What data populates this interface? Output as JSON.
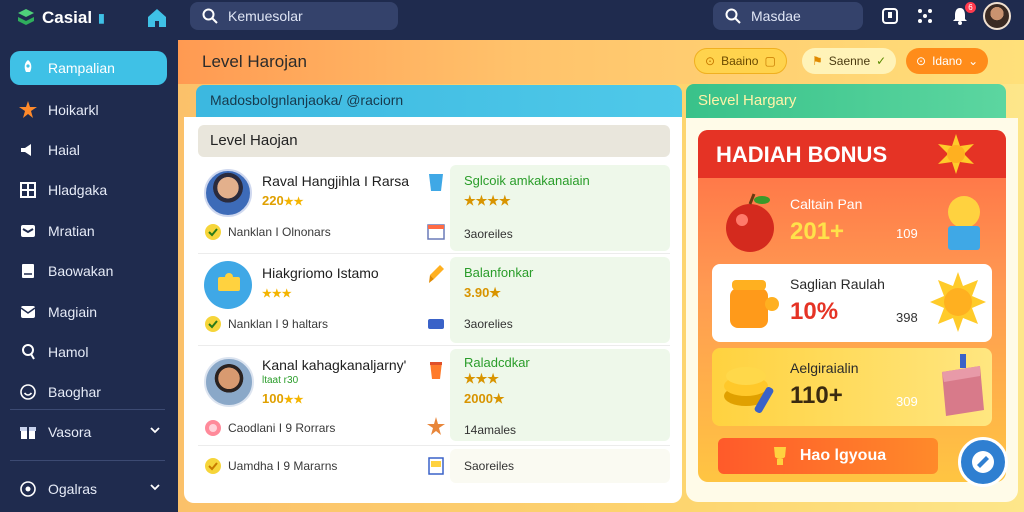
{
  "app": {
    "logo_text": "Casial",
    "top_search_placeholder": "Kemuesolar",
    "top_search2_value": "Masdae",
    "notification_count": "6"
  },
  "sidebar": {
    "items": [
      {
        "label": "Rampalian",
        "icon": "rocket-icon"
      },
      {
        "label": "Hoikarkl",
        "icon": "star-burst-icon"
      },
      {
        "label": "Haial",
        "icon": "speaker-icon"
      },
      {
        "label": "Hladgaka",
        "icon": "grid-icon"
      },
      {
        "label": "Mratian",
        "icon": "mail-icon"
      },
      {
        "label": "Baowakan",
        "icon": "document-icon"
      },
      {
        "label": "Magiain",
        "icon": "envelope-icon"
      },
      {
        "label": "Hamol",
        "icon": "user-icon"
      },
      {
        "label": "Baoghar",
        "icon": "smile-icon"
      },
      {
        "label": "Vasora",
        "icon": "gift-icon"
      },
      {
        "label": "Ogalras",
        "icon": "settings-icon"
      }
    ]
  },
  "header": {
    "title": "Level Harojan",
    "pills": [
      "Baaino",
      "Saenne",
      "Idano"
    ]
  },
  "left": {
    "search_text": "Madosbolgnlanjaoka/ @raciorn",
    "panel_title": "Level Haojan",
    "rows": [
      {
        "name": "Raval Hangjihla I Rarsa",
        "score": "220",
        "stars": "★★",
        "meta": "Nanklan I Olnonars",
        "g_title": "Sglcoik amkakanaiain",
        "g_stars": "★★★★",
        "g_meta": "3aoreiles"
      },
      {
        "name": "Hiakgriomo Istamo",
        "score": "",
        "stars": "★★★",
        "meta": "Nanklan I 9 haltars",
        "g_title": "Balanfonkar",
        "g_stars": "3.90★",
        "g_meta": "3aorelies"
      },
      {
        "name": "Kanal kahagkanaljarny'",
        "score": "100",
        "stars": "★★",
        "sub": "ltaat r30",
        "meta": "Caodlani I 9 Rorrars",
        "g_title": "Raladcdkar",
        "g_stars": "2000★",
        "g_meta": "14amales"
      },
      {
        "name": "",
        "score": "",
        "stars": "",
        "meta": "Uamdha I 9 Mararns",
        "g_title": "",
        "g_stars": "",
        "g_meta": "Saoreiles"
      }
    ]
  },
  "right": {
    "tab_title": "Slevel Hargary",
    "bonus_title": "HADIAH BONUS",
    "rewards": [
      {
        "title": "Caltain Pan",
        "value": "201+",
        "right": "109"
      },
      {
        "title": "Saglian Raulah",
        "value": "10%",
        "right": "398"
      },
      {
        "title": "Aelgiraialin",
        "value": "110+",
        "right": "309"
      }
    ],
    "claim_label": "Hao lgyoua"
  },
  "colors": {
    "accent": "#3fc1e6",
    "sidebar": "#1f2b4e",
    "bonus_red": "#e53325",
    "green_tab": "#39c28a"
  }
}
